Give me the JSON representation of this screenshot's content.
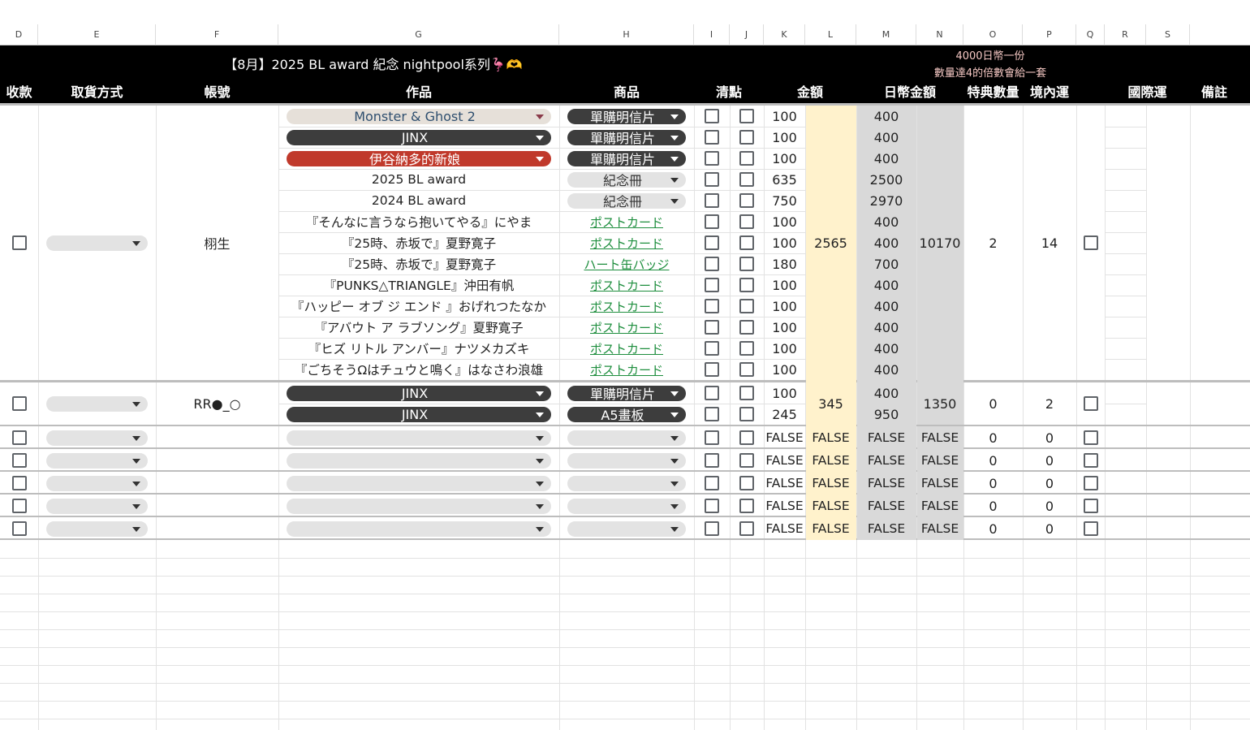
{
  "columns": [
    "D",
    "E",
    "F",
    "G",
    "H",
    "I",
    "J",
    "K",
    "L",
    "M",
    "N",
    "O",
    "P",
    "Q",
    "R",
    "S"
  ],
  "banner": {
    "title": "【8月】2025 BL award 紀念 nightpool系列🦩🫶",
    "note_line1": "4000日幣一份",
    "note_line2": "數量達4的倍數會給一套"
  },
  "headers": {
    "received": "收款",
    "pickup": "取貨方式",
    "account": "帳號",
    "work": "作品",
    "product": "商品",
    "check": "清點",
    "amount": "金額",
    "jpy_amount": "日幣金額",
    "bonus_qty": "特典數量",
    "domestic": "境內運",
    "international": "國際運",
    "remarks": "備註"
  },
  "orders": [
    {
      "account": "栩生",
      "total": "2565",
      "jpy_total": "10170",
      "bonus_qty": "2",
      "domestic": "14",
      "items": [
        {
          "work": "Monster & Ghost 2",
          "work_style": "beige",
          "product": "單購明信片",
          "product_style": "dark",
          "amount": "100",
          "jpy": "400"
        },
        {
          "work": "JINX",
          "work_style": "dark",
          "product": "單購明信片",
          "product_style": "dark",
          "amount": "100",
          "jpy": "400"
        },
        {
          "work": "伊谷納多的新娘",
          "work_style": "red",
          "product": "單購明信片",
          "product_style": "dark",
          "amount": "100",
          "jpy": "400"
        },
        {
          "work": "2025 BL award",
          "work_style": "plain",
          "product": "紀念冊",
          "product_style": "light",
          "amount": "635",
          "jpy": "2500"
        },
        {
          "work": "2024 BL award",
          "work_style": "plain",
          "product": "紀念冊",
          "product_style": "light",
          "amount": "750",
          "jpy": "2970"
        },
        {
          "work": "『そんなに言うなら抱いてやる』にやま",
          "work_style": "plain",
          "product": "ポストカード",
          "product_style": "link",
          "amount": "100",
          "jpy": "400"
        },
        {
          "work": "『25時、赤坂で』夏野寛子",
          "work_style": "plain",
          "product": "ポストカード",
          "product_style": "link",
          "amount": "100",
          "jpy": "400"
        },
        {
          "work": "『25時、赤坂で』夏野寛子",
          "work_style": "plain",
          "product": "ハート缶バッジ",
          "product_style": "link",
          "amount": "180",
          "jpy": "700"
        },
        {
          "work": "『PUNKS△TRIANGLE』沖田有帆",
          "work_style": "plain",
          "product": "ポストカード",
          "product_style": "link",
          "amount": "100",
          "jpy": "400"
        },
        {
          "work": "『ハッピー オブ ジ エンド 』おげれつたなか",
          "work_style": "plain",
          "product": "ポストカード",
          "product_style": "link",
          "amount": "100",
          "jpy": "400"
        },
        {
          "work": "『アバウト ア ラブソング』夏野寛子",
          "work_style": "plain",
          "product": "ポストカード",
          "product_style": "link",
          "amount": "100",
          "jpy": "400"
        },
        {
          "work": "『ヒズ リトル アンバー』ナツメカズキ",
          "work_style": "plain",
          "product": "ポストカード",
          "product_style": "link",
          "amount": "100",
          "jpy": "400"
        },
        {
          "work": "『ごちそうΩはチュウと鳴く』はなさわ浪雄",
          "work_style": "plain",
          "product": "ポストカード",
          "product_style": "link",
          "amount": "100",
          "jpy": "400"
        }
      ]
    },
    {
      "account": "RR●_○",
      "total": "345",
      "jpy_total": "1350",
      "bonus_qty": "0",
      "domestic": "2",
      "items": [
        {
          "work": "JINX",
          "work_style": "dark",
          "product": "單購明信片",
          "product_style": "dark",
          "amount": "100",
          "jpy": "400"
        },
        {
          "work": "JINX",
          "work_style": "dark",
          "product": "A5畫板",
          "product_style": "dark",
          "amount": "245",
          "jpy": "950"
        }
      ]
    }
  ],
  "empty_rows": [
    {
      "k": "FALSE",
      "l": "FALSE",
      "m": "FALSE",
      "n": "FALSE",
      "o": "0",
      "p": "0"
    },
    {
      "k": "FALSE",
      "l": "FALSE",
      "m": "FALSE",
      "n": "FALSE",
      "o": "0",
      "p": "0"
    },
    {
      "k": "FALSE",
      "l": "FALSE",
      "m": "FALSE",
      "n": "FALSE",
      "o": "0",
      "p": "0"
    },
    {
      "k": "FALSE",
      "l": "FALSE",
      "m": "FALSE",
      "n": "FALSE",
      "o": "0",
      "p": "0"
    },
    {
      "k": "FALSE",
      "l": "FALSE",
      "m": "FALSE",
      "n": "FALSE",
      "o": "0",
      "p": "0"
    }
  ],
  "colors": {
    "banner_bg": "#000000",
    "amount_highlight": "#fff2cc",
    "jpy_highlight": "#d9d9d9",
    "chip_dark": "#3d3d3d",
    "chip_red": "#c0392b",
    "chip_beige": "#e6e0d9",
    "chip_light": "#e3e3e3",
    "link_green": "#1e8e3e"
  }
}
